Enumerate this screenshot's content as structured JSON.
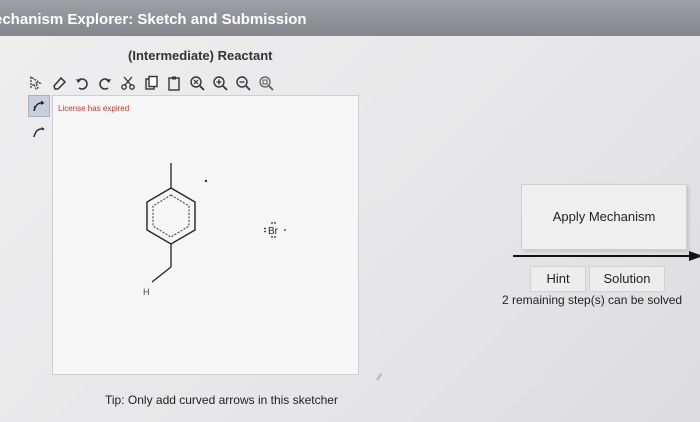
{
  "window": {
    "title": "echanism Explorer: Sketch and Submission"
  },
  "sketcher": {
    "heading": "(Intermediate) Reactant",
    "license_notice": "License has expired",
    "tip": "Tip: Only add curved arrows in this sketcher",
    "toolbar": [
      {
        "icon": "select-arrow-icon"
      },
      {
        "icon": "eraser-icon"
      },
      {
        "icon": "undo-icon"
      },
      {
        "icon": "redo-icon"
      },
      {
        "icon": "cut-icon"
      },
      {
        "icon": "copy-icon"
      },
      {
        "icon": "paste-icon"
      },
      {
        "icon": "zoom-reset-icon"
      },
      {
        "icon": "zoom-in-icon"
      },
      {
        "icon": "zoom-out-icon"
      },
      {
        "icon": "zoom-fit-icon"
      }
    ],
    "left_tools": [
      {
        "icon": "curved-arrow-double-icon",
        "active": true
      },
      {
        "icon": "curved-arrow-single-icon",
        "active": false
      }
    ],
    "molecule": {
      "h_label": "H",
      "br_label": "Br"
    }
  },
  "actions": {
    "apply_label": "Apply Mechanism",
    "hint_label": "Hint",
    "solution_label": "Solution",
    "remaining_text": "2 remaining step(s) can be solved"
  },
  "colors": {
    "title_bar": "#8f9096",
    "license_red": "#c0392b",
    "active_tool": "#c9cedc"
  }
}
